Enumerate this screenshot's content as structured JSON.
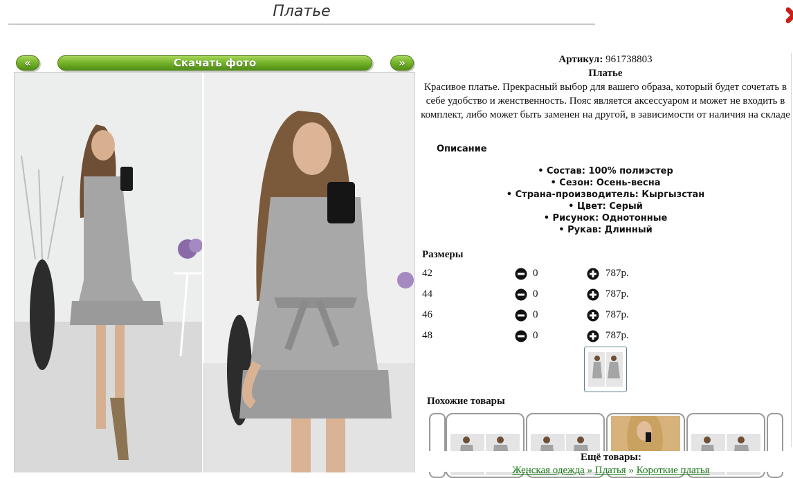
{
  "page": {
    "title": "Платье"
  },
  "gallery": {
    "prev_label": "«",
    "download_label": "Скачать фото",
    "next_label": "»"
  },
  "product": {
    "article_label": "Артикул:",
    "article_value": "961738803",
    "name": "Платье",
    "description": "Красивое платье. Прекрасный выбор для вашего образа, который будет сочетать в себе удобство и женственность. Пояс является аксессуаром и может не входить в комплект, либо может быть заменен на другой, в зависимости от наличия на складе",
    "description_heading": "Описание",
    "attributes": [
      "Состав: 100% полиэстер",
      "Сезон: Осень-весна",
      "Страна-производитель: Кыргызстан",
      "Цвет: Серый",
      "Рисунок: Однотонные",
      "Рукав: Длинный"
    ]
  },
  "sizes": {
    "heading": "Размеры",
    "rows": [
      {
        "size": "42",
        "qty": "0",
        "price": "787р."
      },
      {
        "size": "44",
        "qty": "0",
        "price": "787р."
      },
      {
        "size": "46",
        "qty": "0",
        "price": "787р."
      },
      {
        "size": "48",
        "qty": "0",
        "price": "787р."
      }
    ]
  },
  "similar": {
    "heading": "Похожие товары"
  },
  "more": {
    "heading": "Ещё товары:",
    "crumbs": [
      "Женская одежда",
      "Платья",
      "Короткие платья"
    ],
    "separator": "»"
  },
  "icons": {
    "minus": "minus-circle-icon",
    "plus": "plus-circle-icon",
    "close": "close-icon"
  },
  "colors": {
    "button_green": "#79b52d",
    "link_green": "#1a7a1a"
  }
}
